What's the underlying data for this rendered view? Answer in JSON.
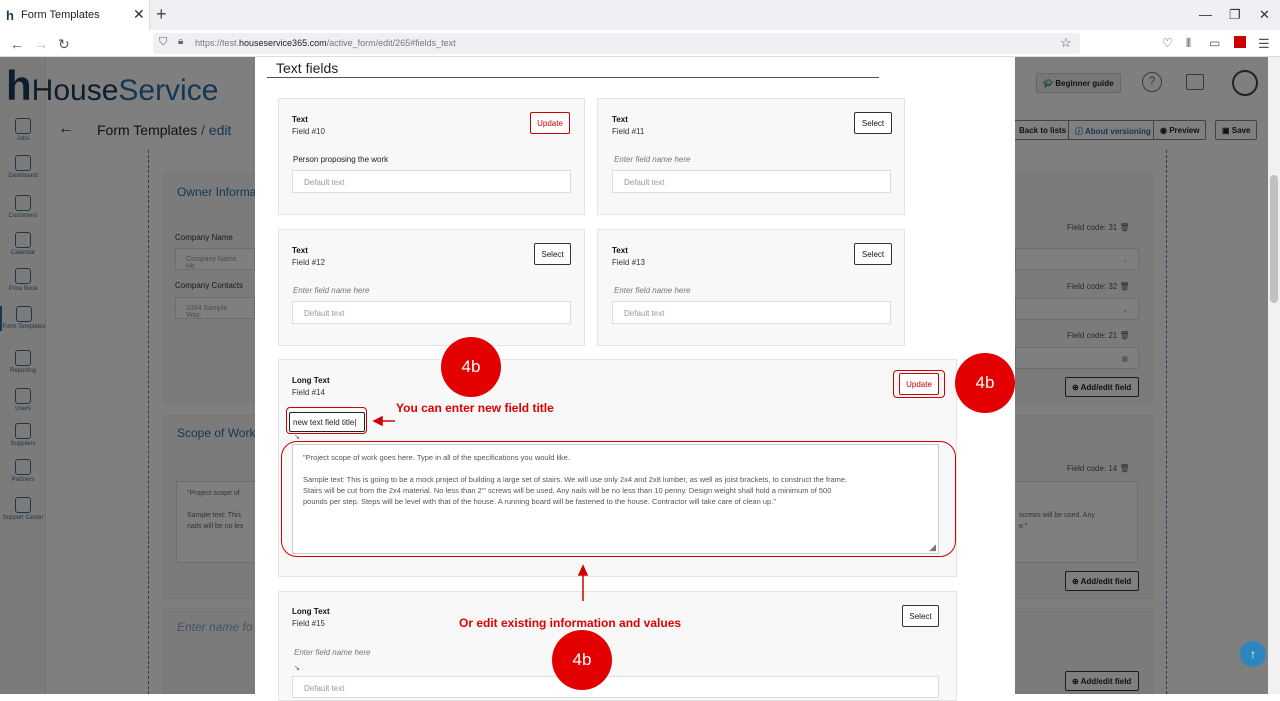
{
  "browser": {
    "tab_title": "Form Templates",
    "url_prefix": "https://test.",
    "url_domain": "houseservice365.com",
    "url_path": "/active_form/edit/265#fields_text"
  },
  "app": {
    "logo_house": "House",
    "logo_service": "Service",
    "beginner_guide": "Beginner guide",
    "page_title": "Form Templates",
    "page_title_sep": " / ",
    "page_title_sub": "edit",
    "back_to_lists": "Back to lists",
    "about_versioning": "About versioning",
    "preview": "Preview",
    "save": "Save",
    "sidebar": [
      "Jobs",
      "Dashboard",
      "Customers",
      "Calendar",
      "Price Book",
      "Form Templates",
      "Reporting",
      "Users",
      "Suppliers",
      "Partners",
      "Support Center"
    ]
  },
  "background": {
    "owner_info": "Owner Informa",
    "company_name": "Company Name",
    "company_name_ph": "Company Name He",
    "company_contacts": "Company Contacts",
    "company_contacts_ph": "2334 Sample Way, ",
    "scope_title": "Scope of Work",
    "scope_text_1": "\"Project scope of",
    "scope_text_2": "Sample text: This",
    "scope_text_3": "nails will be no les",
    "scope_right_1": "screws will be used.  Any",
    "scope_right_2": "e.\"",
    "enter_name": "Enter name fo",
    "field_code_31": "Field code: 31",
    "field_code_32": "Field code: 32",
    "field_code_21": "Field code: 21",
    "field_code_14": "Field code: 14",
    "add_edit_field": "Add/edit field"
  },
  "modal": {
    "title": "Text fields",
    "cards": [
      {
        "type": "Text",
        "field": "Field #10",
        "button": "Update",
        "name": "Person proposing the work",
        "default": "Default text"
      },
      {
        "type": "Text",
        "field": "Field #11",
        "button": "Select",
        "name": "Enter field name here",
        "default": "Default text"
      },
      {
        "type": "Text",
        "field": "Field #12",
        "button": "Select",
        "name": "Enter field name here",
        "default": "Default text"
      },
      {
        "type": "Text",
        "field": "Field #13",
        "button": "Select",
        "name": "Enter field name here",
        "default": "Default text"
      }
    ],
    "long14": {
      "type": "Long Text",
      "field": "Field #14",
      "button": "Update",
      "name_value": "new text field title",
      "text_1": "\"Project scope of work goes here. Type in all of the specifications you would like.",
      "text_2": "Sample text: This is going to be a mock project of building a large set of stairs. We will use only 2x4 and 2x8 lumber, as well as joist brackets, to construct the frame.",
      "text_3": "Stairs will be cut from the 2x4 material. No less than 2\"' screws will be used.  Any nails will be no less than 10 penny. Design weight shall hold a minimum of 500",
      "text_4": "pounds per step. Steps will be level with that of the house. A running board will be fastened to the house. Contractor will take care of clean up.\""
    },
    "long15": {
      "type": "Long Text",
      "field": "Field #15",
      "button": "Select",
      "name": "Enter field name here",
      "default": "Default text"
    }
  },
  "annotations": {
    "badge": "4b",
    "enter_title": "You can enter new field title",
    "edit_existing": "Or edit existing information and values"
  }
}
